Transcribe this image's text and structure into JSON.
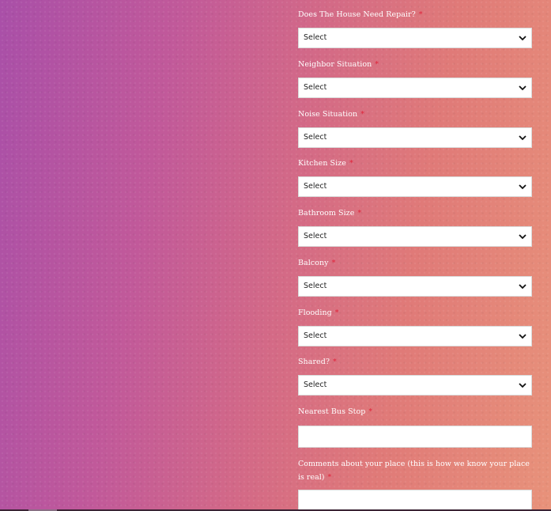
{
  "form": {
    "fields": [
      {
        "label": "Does The House Need Repair?",
        "required_mark": "*",
        "value": "Select"
      },
      {
        "label": "Neighbor Situation",
        "required_mark": "*",
        "value": "Select"
      },
      {
        "label": "Noise Situation",
        "required_mark": "*",
        "value": "Select"
      },
      {
        "label": "Kitchen Size",
        "required_mark": "*",
        "value": "Select"
      },
      {
        "label": "Bathroom Size",
        "required_mark": "*",
        "value": "Select"
      },
      {
        "label": "Balcony",
        "required_mark": "*",
        "value": "Select"
      },
      {
        "label": "Flooding",
        "required_mark": "*",
        "value": "Select"
      },
      {
        "label": "Shared?",
        "required_mark": "*",
        "value": "Select"
      }
    ],
    "bus_stop": {
      "label": "Nearest Bus Stop",
      "required_mark": "*",
      "value": ""
    },
    "comments": {
      "label": "Comments about your place (this is how we know your place is real)",
      "required_mark": "*",
      "value": ""
    }
  },
  "colors": {
    "label_text": "#ffffff",
    "required": "#e0243a",
    "gradient_start": "#a94fa8",
    "gradient_end": "#e8927a"
  },
  "icons": {
    "dropdown": "chevron-down-icon"
  }
}
